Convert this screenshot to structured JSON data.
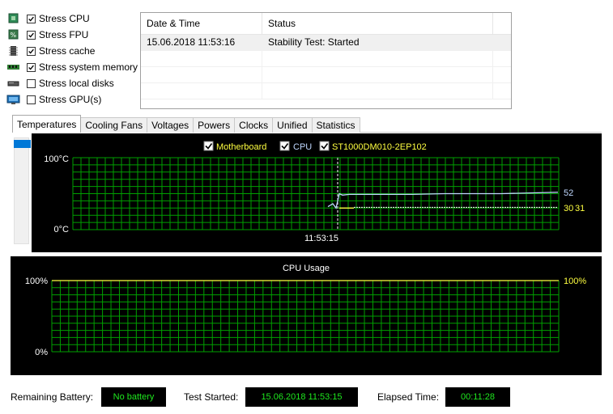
{
  "stress_options": [
    {
      "label": "Stress CPU",
      "checked": true,
      "icon": "cpu-icon"
    },
    {
      "label": "Stress FPU",
      "checked": true,
      "icon": "fpu-icon"
    },
    {
      "label": "Stress cache",
      "checked": true,
      "icon": "cache-icon"
    },
    {
      "label": "Stress system memory",
      "checked": true,
      "icon": "memory-icon"
    },
    {
      "label": "Stress local disks",
      "checked": false,
      "icon": "disk-icon"
    },
    {
      "label": "Stress GPU(s)",
      "checked": false,
      "icon": "gpu-icon"
    }
  ],
  "log": {
    "columns": [
      "Date & Time",
      "Status"
    ],
    "rows": [
      [
        "15.06.2018 11:53:16",
        "Stability Test: Started"
      ]
    ]
  },
  "tabs": [
    "Temperatures",
    "Cooling Fans",
    "Voltages",
    "Powers",
    "Clocks",
    "Unified",
    "Statistics"
  ],
  "active_tab": "Temperatures",
  "colors": {
    "grid": "#00a000",
    "motherboard": "#ffff40",
    "cpu": "#c0d8ff",
    "disk": "#ffffff",
    "lcd_text": "#1ee81e"
  },
  "chart_data": [
    {
      "type": "line",
      "title": "",
      "legend": [
        "Motherboard",
        "CPU",
        "ST1000DM010-2EP102"
      ],
      "ylim": [
        0,
        100
      ],
      "y_tick_labels": [
        "100°C",
        "0°C"
      ],
      "marker_time": "11:53:15",
      "series": [
        {
          "name": "Motherboard",
          "current": 30
        },
        {
          "name": "CPU",
          "current": 52
        },
        {
          "name": "ST1000DM010-2EP102",
          "current": 31
        }
      ],
      "value_labels": [
        "52",
        "30",
        "31"
      ]
    },
    {
      "type": "line",
      "title": "CPU Usage",
      "ylim": [
        0,
        100
      ],
      "y_tick_labels": [
        "100%",
        "0%"
      ],
      "series": [
        {
          "name": "CPU Usage",
          "current": 100
        }
      ],
      "value_labels": [
        "100%"
      ]
    }
  ],
  "status": {
    "battery_label": "Remaining Battery:",
    "battery_value": "No battery",
    "started_label": "Test Started:",
    "started_value": "15.06.2018 11:53:15",
    "elapsed_label": "Elapsed Time:",
    "elapsed_value": "00:11:28"
  }
}
